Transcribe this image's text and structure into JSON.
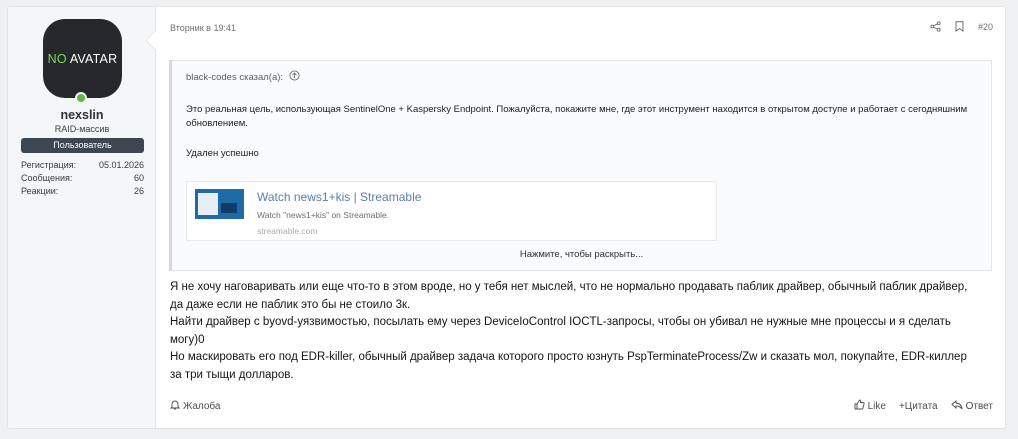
{
  "user": {
    "avatar_text_a": "NO",
    "avatar_text_b": "AVATAR",
    "name": "nexslin",
    "title": "RAID-массив",
    "banner": "Пользователь",
    "stats": [
      {
        "label": "Регистрация:",
        "value": "05.01.2026"
      },
      {
        "label": "Сообщения:",
        "value": "60"
      },
      {
        "label": "Реакции:",
        "value": "26"
      }
    ]
  },
  "post": {
    "date": "Вторник в 19:41",
    "number": "#20",
    "quote": {
      "author": "black-codes сказал(а):",
      "paragraphs": [
        "Это реальная цель, использующая SentinelOne + Kaspersky Endpoint. Пожалуйста, покажите мне, где этот инструмент находится в открытом доступе и работает с сегодняшним обновлением.",
        "Удален успешно"
      ],
      "embed": {
        "title": "Watch news1+kis | Streamable",
        "description": "Watch \"news1+kis\" on Streamable.",
        "url": "streamable.com"
      },
      "expand": "Нажмите, чтобы раскрыть..."
    },
    "paragraphs": [
      "Я не хочу наговаривать или еще что-то в этом вроде, но у тебя нет мыслей, что не нормально продавать паблик драйвер, обычный паблик драйвер, да даже если не паблик это бы не стоило 3к.",
      "Найти драйвер с byovd-уязвимостью, посылать ему через DeviceIoControl IOCTL-запросы, чтобы он убивал не нужные мне процессы и я сделать могу)0",
      "Но маскировать его под EDR-killer, обычный драйвер задача которого просто юзнуть PspTerminateProcess/Zw и сказать мол, покупайте, EDR-киллер за три тыщи долларов."
    ]
  },
  "footer": {
    "report": "Жалоба",
    "like": "Like",
    "quote": "+Цитата",
    "reply": "Ответ"
  },
  "colors": {
    "banner": "#3d4652",
    "online": "#65b648",
    "link": "#5b7db8"
  },
  "icons": [
    "share-icon",
    "bookmark-icon",
    "arrow-up-circle-icon",
    "bell-icon",
    "thumbs-up-icon",
    "reply-icon"
  ]
}
